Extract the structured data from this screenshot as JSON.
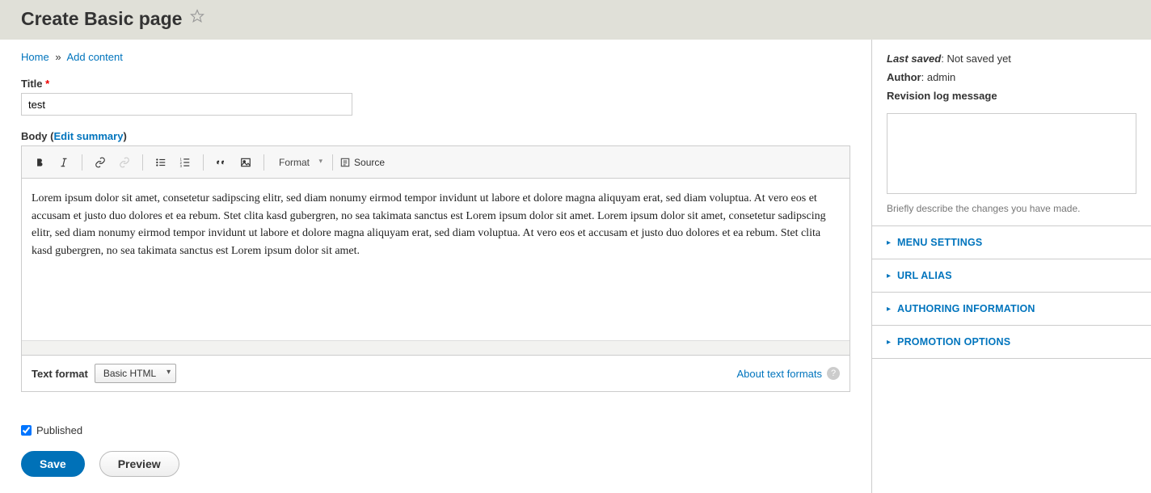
{
  "header": {
    "title": "Create Basic page"
  },
  "breadcrumb": {
    "home": "Home",
    "add_content": "Add content"
  },
  "form": {
    "title_label": "Title",
    "title_value": "test",
    "body_label": "Body",
    "edit_summary": "Edit summary",
    "body_content": "Lorem ipsum dolor sit amet, consetetur sadipscing elitr, sed diam nonumy eirmod tempor invidunt ut labore et dolore magna aliquyam erat, sed diam voluptua. At vero eos et accusam et justo duo dolores et ea rebum. Stet clita kasd gubergren, no sea takimata sanctus est Lorem ipsum dolor sit amet. Lorem ipsum dolor sit amet, consetetur sadipscing elitr, sed diam nonumy eirmod tempor invidunt ut labore et dolore magna aliquyam erat, sed diam voluptua. At vero eos et accusam et justo duo dolores et ea rebum. Stet clita kasd gubergren, no sea takimata sanctus est Lorem ipsum dolor sit amet.",
    "format_dropdown_label": "Format",
    "source_label": "Source",
    "text_format_label": "Text format",
    "text_format_value": "Basic HTML",
    "about_formats": "About text formats",
    "published_label": "Published",
    "published_checked": true,
    "save_label": "Save",
    "preview_label": "Preview"
  },
  "sidebar": {
    "last_saved_label": "Last saved",
    "last_saved_value": "Not saved yet",
    "author_label": "Author",
    "author_value": "admin",
    "revision_label": "Revision log message",
    "revision_help": "Briefly describe the changes you have made.",
    "accordion": [
      "MENU SETTINGS",
      "URL ALIAS",
      "AUTHORING INFORMATION",
      "PROMOTION OPTIONS"
    ]
  }
}
